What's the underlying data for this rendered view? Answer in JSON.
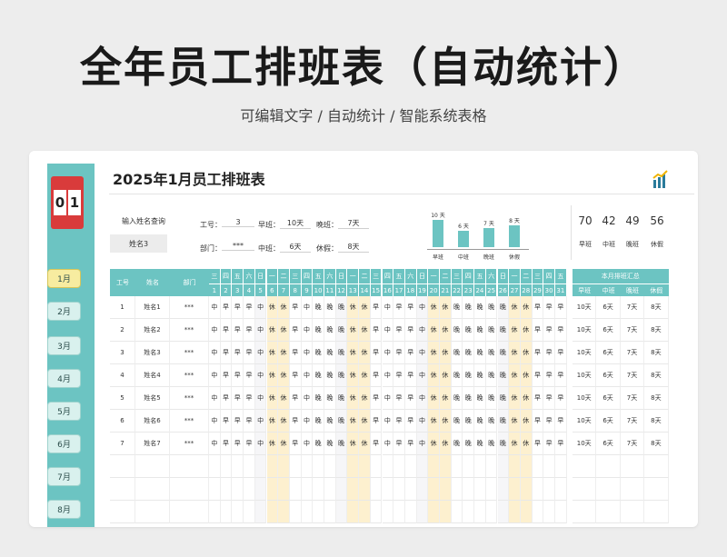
{
  "hero": {
    "title": "全年员工排班表（自动统计）",
    "subtitle": "可编辑文字 / 自动统计 / 智能系统表格"
  },
  "sidebar": {
    "month_digits": [
      "0",
      "1"
    ],
    "months": [
      "1月",
      "2月",
      "3月",
      "4月",
      "5月",
      "6月",
      "7月",
      "8月"
    ],
    "active_month": "1月"
  },
  "sheet": {
    "title": "2025年1月员工排班表",
    "icon": "bar-chart-icon"
  },
  "query": {
    "label": "输入姓名查询",
    "value": "姓名3"
  },
  "info": {
    "id_label": "工号：",
    "id_value": "3",
    "dept_label": "部门：",
    "dept_value": "***",
    "morning_label": "早班：",
    "morning_value": "10天",
    "middle_label": "中班：",
    "middle_value": "6天",
    "night_label": "晚班：",
    "night_value": "7天",
    "rest_label": "休假：",
    "rest_value": "8天"
  },
  "mini_chart": {
    "type": "bar",
    "categories": [
      "早班",
      "中班",
      "晚班",
      "休假"
    ],
    "values": [
      10,
      6,
      7,
      8
    ],
    "value_labels": [
      "10 天",
      "6 天",
      "7 天",
      "8 天"
    ]
  },
  "stats": [
    {
      "value": "70",
      "label": "早班"
    },
    {
      "value": "42",
      "label": "中班"
    },
    {
      "value": "49",
      "label": "晚班"
    },
    {
      "value": "56",
      "label": "休假"
    }
  ],
  "table": {
    "headers": {
      "id": "工号",
      "name": "姓名",
      "dept": "部门",
      "summary": "本月排班汇总"
    },
    "weekdays": [
      "三",
      "四",
      "五",
      "六",
      "日",
      "一",
      "二",
      "三",
      "四",
      "五",
      "六",
      "日",
      "一",
      "二",
      "三",
      "四",
      "五",
      "六",
      "日",
      "一",
      "二",
      "三",
      "四",
      "五",
      "六",
      "日",
      "一",
      "二",
      "三",
      "四",
      "五"
    ],
    "days": [
      "1",
      "2",
      "3",
      "4",
      "5",
      "6",
      "7",
      "8",
      "9",
      "10",
      "11",
      "12",
      "13",
      "14",
      "15",
      "16",
      "17",
      "18",
      "19",
      "20",
      "21",
      "22",
      "23",
      "24",
      "25",
      "26",
      "27",
      "28",
      "29",
      "30",
      "31"
    ],
    "summary_cols": [
      "早班",
      "中班",
      "晚班",
      "休假"
    ],
    "rows": [
      {
        "id": "1",
        "name": "姓名1",
        "dept": "***",
        "shifts": [
          "中",
          "早",
          "早",
          "早",
          "中",
          "休",
          "休",
          "早",
          "中",
          "晚",
          "晚",
          "晚",
          "休",
          "休",
          "早",
          "中",
          "早",
          "早",
          "中",
          "休",
          "休",
          "晚",
          "晚",
          "晚",
          "晚",
          "晚",
          "休",
          "休",
          "早",
          "早",
          "早"
        ],
        "summary": [
          "10天",
          "6天",
          "7天",
          "8天"
        ]
      },
      {
        "id": "2",
        "name": "姓名2",
        "dept": "***",
        "shifts": [
          "中",
          "早",
          "早",
          "早",
          "中",
          "休",
          "休",
          "早",
          "中",
          "晚",
          "晚",
          "晚",
          "休",
          "休",
          "早",
          "中",
          "早",
          "早",
          "中",
          "休",
          "休",
          "晚",
          "晚",
          "晚",
          "晚",
          "晚",
          "休",
          "休",
          "早",
          "早",
          "早"
        ],
        "summary": [
          "10天",
          "6天",
          "7天",
          "8天"
        ]
      },
      {
        "id": "3",
        "name": "姓名3",
        "dept": "***",
        "shifts": [
          "中",
          "早",
          "早",
          "早",
          "中",
          "休",
          "休",
          "早",
          "中",
          "晚",
          "晚",
          "晚",
          "休",
          "休",
          "早",
          "中",
          "早",
          "早",
          "中",
          "休",
          "休",
          "晚",
          "晚",
          "晚",
          "晚",
          "晚",
          "休",
          "休",
          "早",
          "早",
          "早"
        ],
        "summary": [
          "10天",
          "6天",
          "7天",
          "8天"
        ]
      },
      {
        "id": "4",
        "name": "姓名4",
        "dept": "***",
        "shifts": [
          "中",
          "早",
          "早",
          "早",
          "中",
          "休",
          "休",
          "早",
          "中",
          "晚",
          "晚",
          "晚",
          "休",
          "休",
          "早",
          "中",
          "早",
          "早",
          "中",
          "休",
          "休",
          "晚",
          "晚",
          "晚",
          "晚",
          "晚",
          "休",
          "休",
          "早",
          "早",
          "早"
        ],
        "summary": [
          "10天",
          "6天",
          "7天",
          "8天"
        ]
      },
      {
        "id": "5",
        "name": "姓名5",
        "dept": "***",
        "shifts": [
          "中",
          "早",
          "早",
          "早",
          "中",
          "休",
          "休",
          "早",
          "中",
          "晚",
          "晚",
          "晚",
          "休",
          "休",
          "早",
          "中",
          "早",
          "早",
          "中",
          "休",
          "休",
          "晚",
          "晚",
          "晚",
          "晚",
          "晚",
          "休",
          "休",
          "早",
          "早",
          "早"
        ],
        "summary": [
          "10天",
          "6天",
          "7天",
          "8天"
        ]
      },
      {
        "id": "6",
        "name": "姓名6",
        "dept": "***",
        "shifts": [
          "中",
          "早",
          "早",
          "早",
          "中",
          "休",
          "休",
          "早",
          "中",
          "晚",
          "晚",
          "晚",
          "休",
          "休",
          "早",
          "中",
          "早",
          "早",
          "中",
          "休",
          "休",
          "晚",
          "晚",
          "晚",
          "晚",
          "晚",
          "休",
          "休",
          "早",
          "早",
          "早"
        ],
        "summary": [
          "10天",
          "6天",
          "7天",
          "8天"
        ]
      },
      {
        "id": "7",
        "name": "姓名7",
        "dept": "***",
        "shifts": [
          "中",
          "早",
          "早",
          "早",
          "中",
          "休",
          "休",
          "早",
          "中",
          "晚",
          "晚",
          "晚",
          "休",
          "休",
          "早",
          "中",
          "早",
          "早",
          "中",
          "休",
          "休",
          "晚",
          "晚",
          "晚",
          "晚",
          "晚",
          "休",
          "休",
          "早",
          "早",
          "早"
        ],
        "summary": [
          "10天",
          "6天",
          "7天",
          "8天"
        ]
      }
    ],
    "empty_rows": 3
  },
  "colors": {
    "accent": "#6cc4c2",
    "weekend": "#fdf0cf",
    "month_box": "#d93b3b",
    "active_month": "#f7eca0"
  }
}
